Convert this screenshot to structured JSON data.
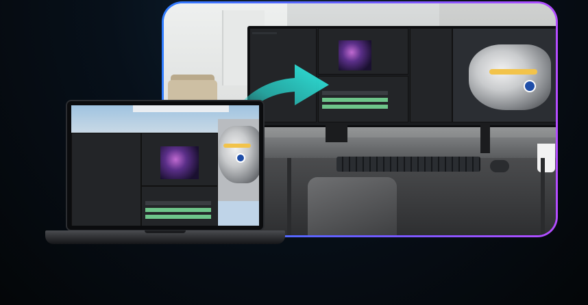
{
  "scene": {
    "description_colors": {
      "frame_gradient_start": "#2f7cff",
      "frame_gradient_end": "#b44cff",
      "arrow_color": "#27d8d0",
      "background": "#040608"
    },
    "icons": [
      "transfer-arrow-icon",
      "laptop-icon",
      "monitor-icon"
    ]
  }
}
